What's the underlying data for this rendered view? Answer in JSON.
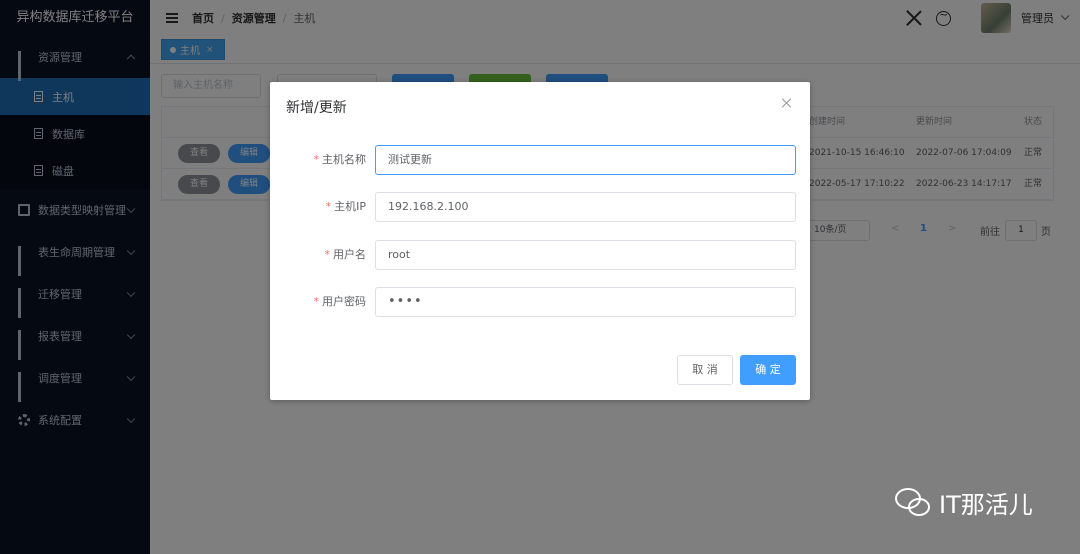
{
  "app": {
    "title": "异构数据库迁移平台"
  },
  "sidebar": {
    "items": [
      {
        "label": "资源管理",
        "expanded": true,
        "children": [
          {
            "label": "主机",
            "active": true
          },
          {
            "label": "数据库"
          },
          {
            "label": "磁盘"
          }
        ]
      },
      {
        "label": "数据类型映射管理"
      },
      {
        "label": "表生命周期管理"
      },
      {
        "label": "迁移管理"
      },
      {
        "label": "报表管理"
      },
      {
        "label": "调度管理"
      },
      {
        "label": "系统配置"
      }
    ]
  },
  "header": {
    "breadcrumb": [
      "首页",
      "资源管理",
      "主机"
    ],
    "breadcrumb_sep": "/",
    "user_name": "管理员"
  },
  "tags": {
    "active_tag": "主机",
    "close": "×"
  },
  "list": {
    "search_placeholder": "输入主机名称",
    "columns": {
      "created": "创建时间",
      "updated": "更新时间",
      "status": "状态"
    },
    "rows": [
      {
        "view": "查看",
        "edit": "编辑",
        "created": "2021-10-15 16:46:10",
        "updated": "2022-07-06 17:04:09",
        "status": "正常"
      },
      {
        "view": "查看",
        "edit": "编辑",
        "created": "2022-05-17 17:10:22",
        "updated": "2022-06-23 14:17:17",
        "status": "正常"
      }
    ],
    "pagination": {
      "page_size": "10条/页",
      "prev": "<",
      "current_page": "1",
      "next": ">",
      "goto_label": "前往",
      "goto_value": "1",
      "page_unit": "页"
    }
  },
  "dialog": {
    "title": "新增/更新",
    "required_mark": "*",
    "fields": {
      "host_name": {
        "label": "主机名称",
        "value": "测试更新"
      },
      "host_ip": {
        "label": "主机IP",
        "value": "192.168.2.100"
      },
      "username": {
        "label": "用户名",
        "value": "root"
      },
      "password": {
        "label": "用户密码",
        "value": "••••"
      }
    },
    "cancel_label": "取 消",
    "ok_label": "确 定"
  },
  "watermark": {
    "text": "IT那活儿"
  },
  "colors": {
    "primary": "#409eff",
    "sidebar_bg": "#0b1325",
    "active_menu": "#1f6fb8",
    "required": "#f56c6c"
  }
}
